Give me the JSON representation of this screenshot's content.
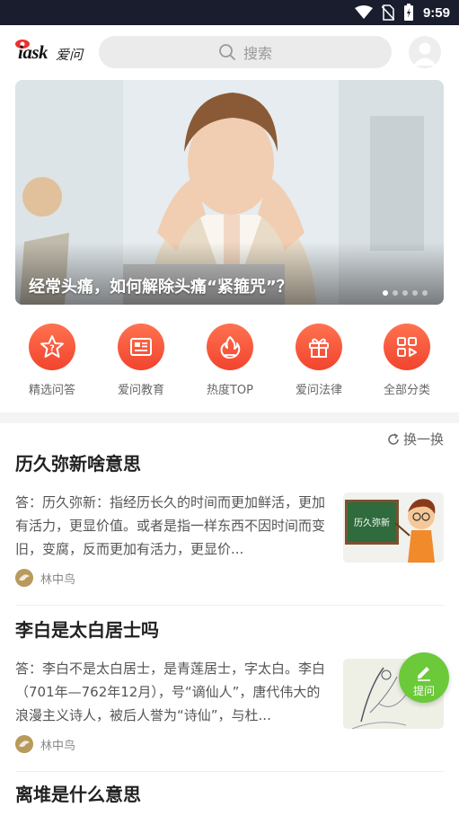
{
  "status_bar": {
    "time": "9:59"
  },
  "header": {
    "logo_text": "iask",
    "logo_cn": "爱问",
    "search_placeholder": "搜索"
  },
  "banner": {
    "caption": "经常头痛，如何解除头痛“紧箍咒”？",
    "slide_count": 5,
    "active_slide": 1
  },
  "categories": [
    {
      "label": "精选问答",
      "icon": "star-question-icon"
    },
    {
      "label": "爱问教育",
      "icon": "newspaper-icon"
    },
    {
      "label": "热度TOP",
      "icon": "flame-icon"
    },
    {
      "label": "爱问法律",
      "icon": "gift-icon"
    },
    {
      "label": "全部分类",
      "icon": "grid-icon"
    }
  ],
  "feed": {
    "refresh_label": "换一换",
    "cards": [
      {
        "title": "历久弥新啥意思",
        "text": "答：历久弥新：指经历长久的时间而更加鲜活，更加有活力，更显价值。或者是指一样东西不因时间而变旧，变腐，反而更加有活力，更显价...",
        "thumb_text": "历久弥新",
        "author": "林中鸟"
      },
      {
        "title": "李白是太白居士吗",
        "text": "答：李白不是太白居士，是青莲居士，字太白。李白（701年—762年12月），号“谪仙人”，唐代伟大的浪漫主义诗人，被后人誉为“诗仙”，与杜...",
        "author": "林中鸟"
      },
      {
        "title": "离堆是什么意思"
      }
    ]
  },
  "fab": {
    "label": "提问"
  },
  "colors": {
    "accent": "#f2442e",
    "fab": "#6cc93a"
  }
}
